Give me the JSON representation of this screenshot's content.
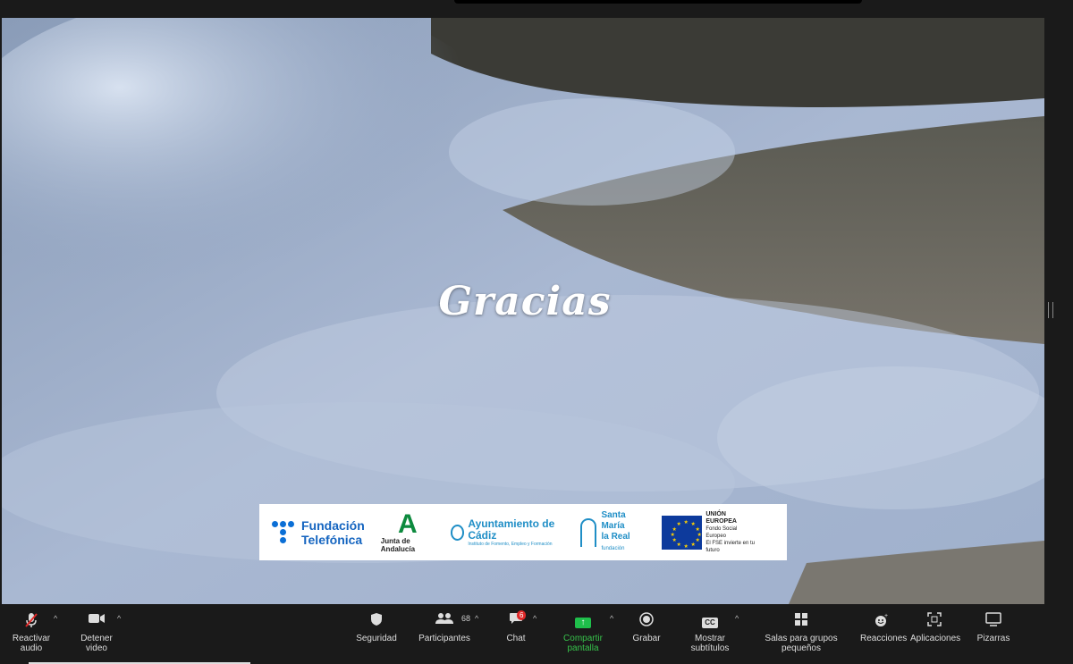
{
  "slide": {
    "title": "Gracias",
    "logos": {
      "fundacion_telefonica": {
        "line1": "Fundación",
        "line2": "Telefónica"
      },
      "junta": {
        "mark": "A",
        "name": "Junta de Andalucía"
      },
      "ayuntamiento": {
        "name": "Ayuntamiento de Cádiz",
        "sub": "Instituto de Fomento, Empleo y Formación"
      },
      "santa_maria": {
        "line1": "Santa María",
        "line2": "la Real",
        "sub": "fundación"
      },
      "eu": {
        "title": "UNIÓN EUROPEA",
        "line2": "Fondo Social Europeo",
        "line3": "El FSE invierte en tu futuro"
      }
    }
  },
  "toolbar": {
    "audio": {
      "label": "Reactivar audio",
      "icon": "microphone-muted-icon"
    },
    "video": {
      "label": "Detener video",
      "icon": "video-camera-icon"
    },
    "security": {
      "label": "Seguridad",
      "icon": "shield-icon"
    },
    "participants": {
      "label": "Participantes",
      "count": "68",
      "icon": "participants-icon"
    },
    "chat": {
      "label": "Chat",
      "badge": "6",
      "icon": "chat-icon"
    },
    "share": {
      "label": "Compartir pantalla",
      "icon": "share-screen-icon"
    },
    "record": {
      "label": "Grabar",
      "icon": "record-icon"
    },
    "captions": {
      "label": "Mostrar subtítulos",
      "icon": "cc-icon",
      "icon_text": "CC"
    },
    "breakout": {
      "label": "Salas para grupos pequeños",
      "icon": "grid-icon"
    },
    "reactions": {
      "label": "Reacciones",
      "icon": "emoji-icon"
    },
    "apps": {
      "label": "Aplicaciones",
      "icon": "apps-icon"
    },
    "whiteboards": {
      "label": "Pizarras",
      "icon": "whiteboard-icon"
    }
  },
  "colors": {
    "share_green": "#37c24b",
    "toolbar_bg": "#1a1a1a",
    "badge_red": "#e02828"
  }
}
